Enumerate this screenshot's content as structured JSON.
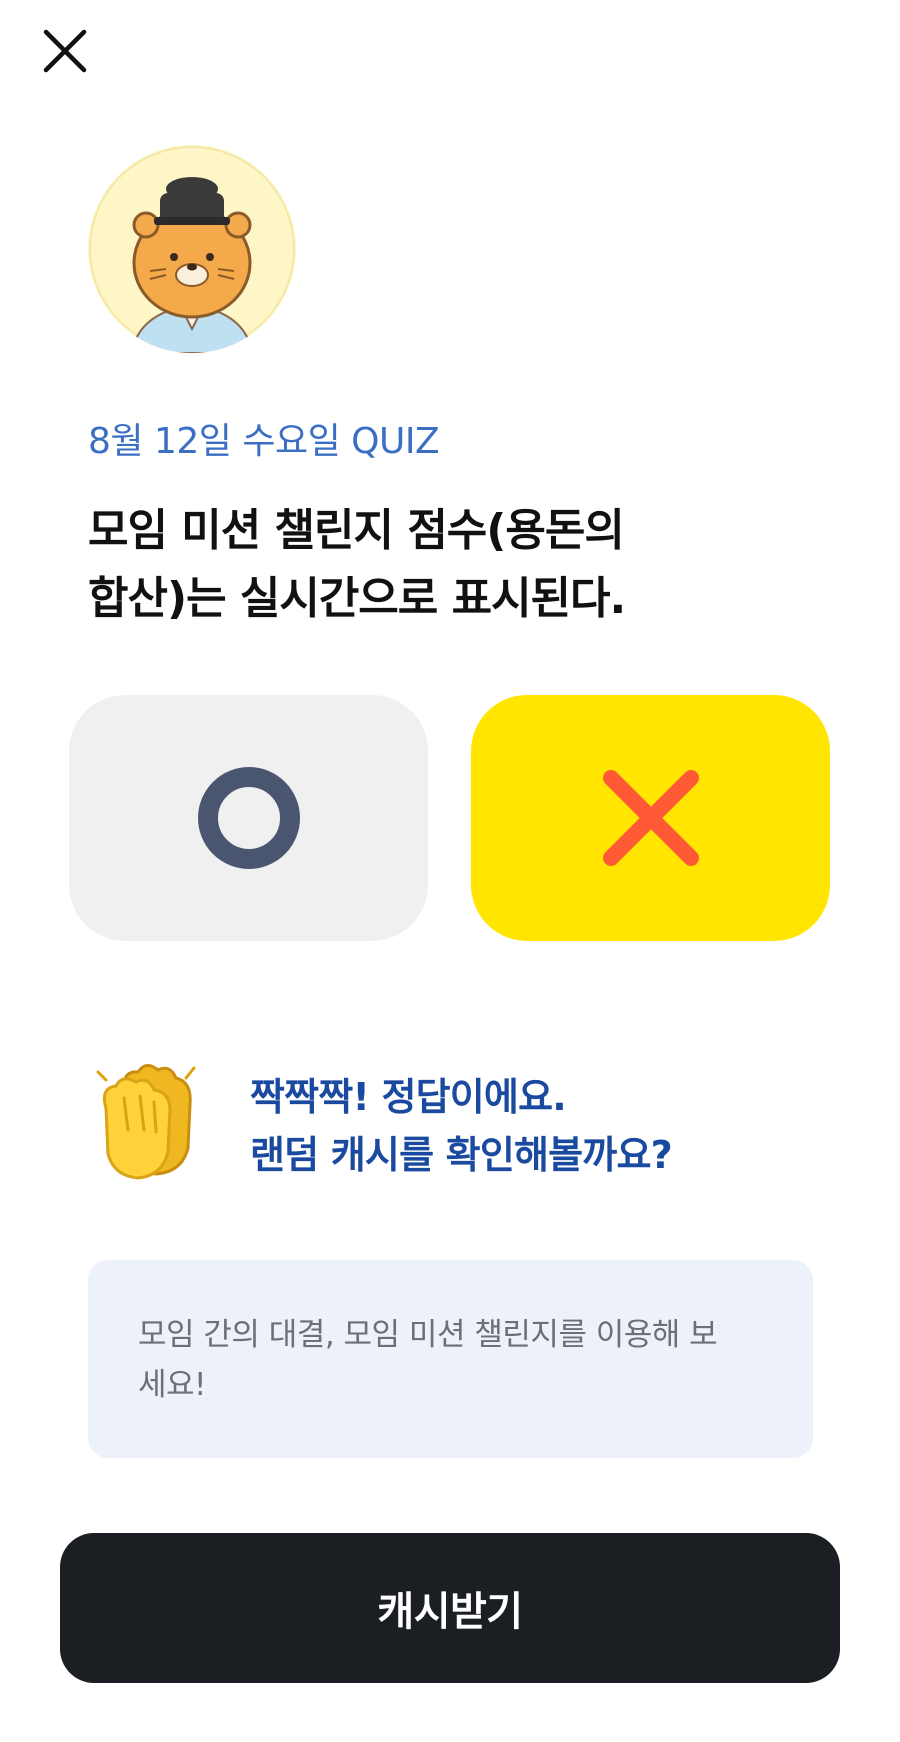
{
  "header": {
    "close_icon": "close-icon"
  },
  "quiz": {
    "date_label": "8월 12일 수요일 QUIZ",
    "question_line1": "모임 미션 챌린지 점수(용돈의",
    "question_line2": "합산)는 실시간으로 표시된다."
  },
  "answers": {
    "o_icon": "circle-icon",
    "x_icon": "cross-icon",
    "selected": "x",
    "o_color": "#4a5670",
    "x_color": "#ff5a36",
    "x_bg": "#ffe500",
    "o_bg": "#f0f0f1"
  },
  "result": {
    "icon": "clapping-hands-icon",
    "line1": "짝짝짝! 정답이에요.",
    "line2": "랜덤 캐시를 확인해볼까요?"
  },
  "tip": {
    "text": "모임 간의 대결, 모임 미션 챌린지를 이용해 보세요!"
  },
  "cta": {
    "label": "캐시받기"
  }
}
